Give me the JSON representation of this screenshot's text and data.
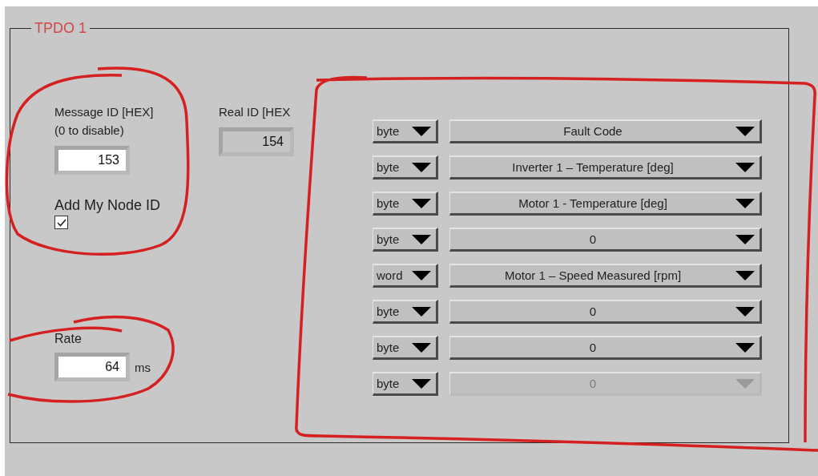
{
  "group": {
    "title": "TPDO 1"
  },
  "message_id": {
    "label_lines": [
      "Message ID [HEX]",
      "(0 to disable)"
    ],
    "value": "153",
    "disabled": false
  },
  "real_id": {
    "label_lines": [
      "Real ID [HEX"
    ],
    "value": "154",
    "disabled": true
  },
  "add_node_id": {
    "label": "Add My Node ID",
    "checked": true
  },
  "rate": {
    "label": "Rate",
    "value": "64",
    "unit": "ms"
  },
  "mappings": [
    {
      "type": "byte",
      "signal": "Fault Code",
      "disabled": false
    },
    {
      "type": "byte",
      "signal": "Inverter 1 – Temperature [deg]",
      "disabled": false
    },
    {
      "type": "byte",
      "signal": "Motor 1 - Temperature [deg]",
      "disabled": false
    },
    {
      "type": "byte",
      "signal": "0",
      "disabled": false
    },
    {
      "type": "word",
      "signal": "Motor 1 – Speed Measured [rpm]",
      "disabled": false
    },
    {
      "type": "byte",
      "signal": "0",
      "disabled": false
    },
    {
      "type": "byte",
      "signal": "0",
      "disabled": false
    },
    {
      "type": "byte",
      "signal": "0",
      "disabled": true
    }
  ]
}
